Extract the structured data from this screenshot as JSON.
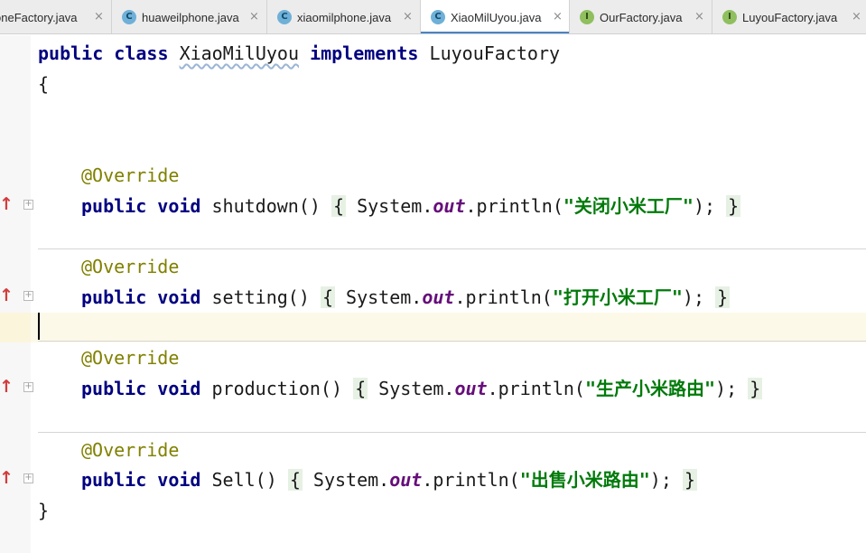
{
  "tabs": [
    {
      "label": "oneFactory.java",
      "icon": "class-icon",
      "icon_glyph": "",
      "active": false,
      "clipped": true
    },
    {
      "label": "huaweilphone.java",
      "icon": "class-icon",
      "icon_glyph": "C",
      "active": false,
      "clipped": false
    },
    {
      "label": "xiaomilphone.java",
      "icon": "class-icon",
      "icon_glyph": "C",
      "active": false,
      "clipped": false
    },
    {
      "label": "XiaoMilUyou.java",
      "icon": "class-icon",
      "icon_glyph": "C",
      "active": true,
      "clipped": false
    },
    {
      "label": "OurFactory.java",
      "icon": "interface-icon",
      "icon_glyph": "I",
      "active": false,
      "clipped": false
    },
    {
      "label": "LuyouFactory.java",
      "icon": "interface-icon",
      "icon_glyph": "I",
      "active": false,
      "clipped": false
    }
  ],
  "tab_close_glyph": "×",
  "gutter": {
    "implements_glyph": "↑",
    "fold_glyph": "+"
  },
  "code": {
    "class_decl": {
      "kw_public": "public",
      "kw_class": "class",
      "class_name": "XiaoMilUyou",
      "kw_implements": "implements",
      "interface_name": "LuyouFactory"
    },
    "open_brace": "{",
    "close_brace": "}",
    "annotation": "@Override",
    "kw_public": "public",
    "kw_void": "void",
    "system": "System.",
    "out": "out",
    "println": ".println(",
    "call_close": ");",
    "methods": [
      {
        "name": "shutdown()",
        "string": "\"关闭小米工厂\""
      },
      {
        "name": "setting()",
        "string": "\"打开小米工厂\""
      },
      {
        "name": "production()",
        "string": "\"生产小米路由\""
      },
      {
        "name": "Sell()",
        "string": "\"出售小米路由\""
      }
    ]
  },
  "colors": {
    "keyword": "#000080",
    "annotation": "#808000",
    "string": "#007a0a",
    "static_field": "#660e7a",
    "active_tab_underline": "#4a83c4",
    "caret_line": "#fcf9e8",
    "implements_marker": "#d23c3c"
  }
}
